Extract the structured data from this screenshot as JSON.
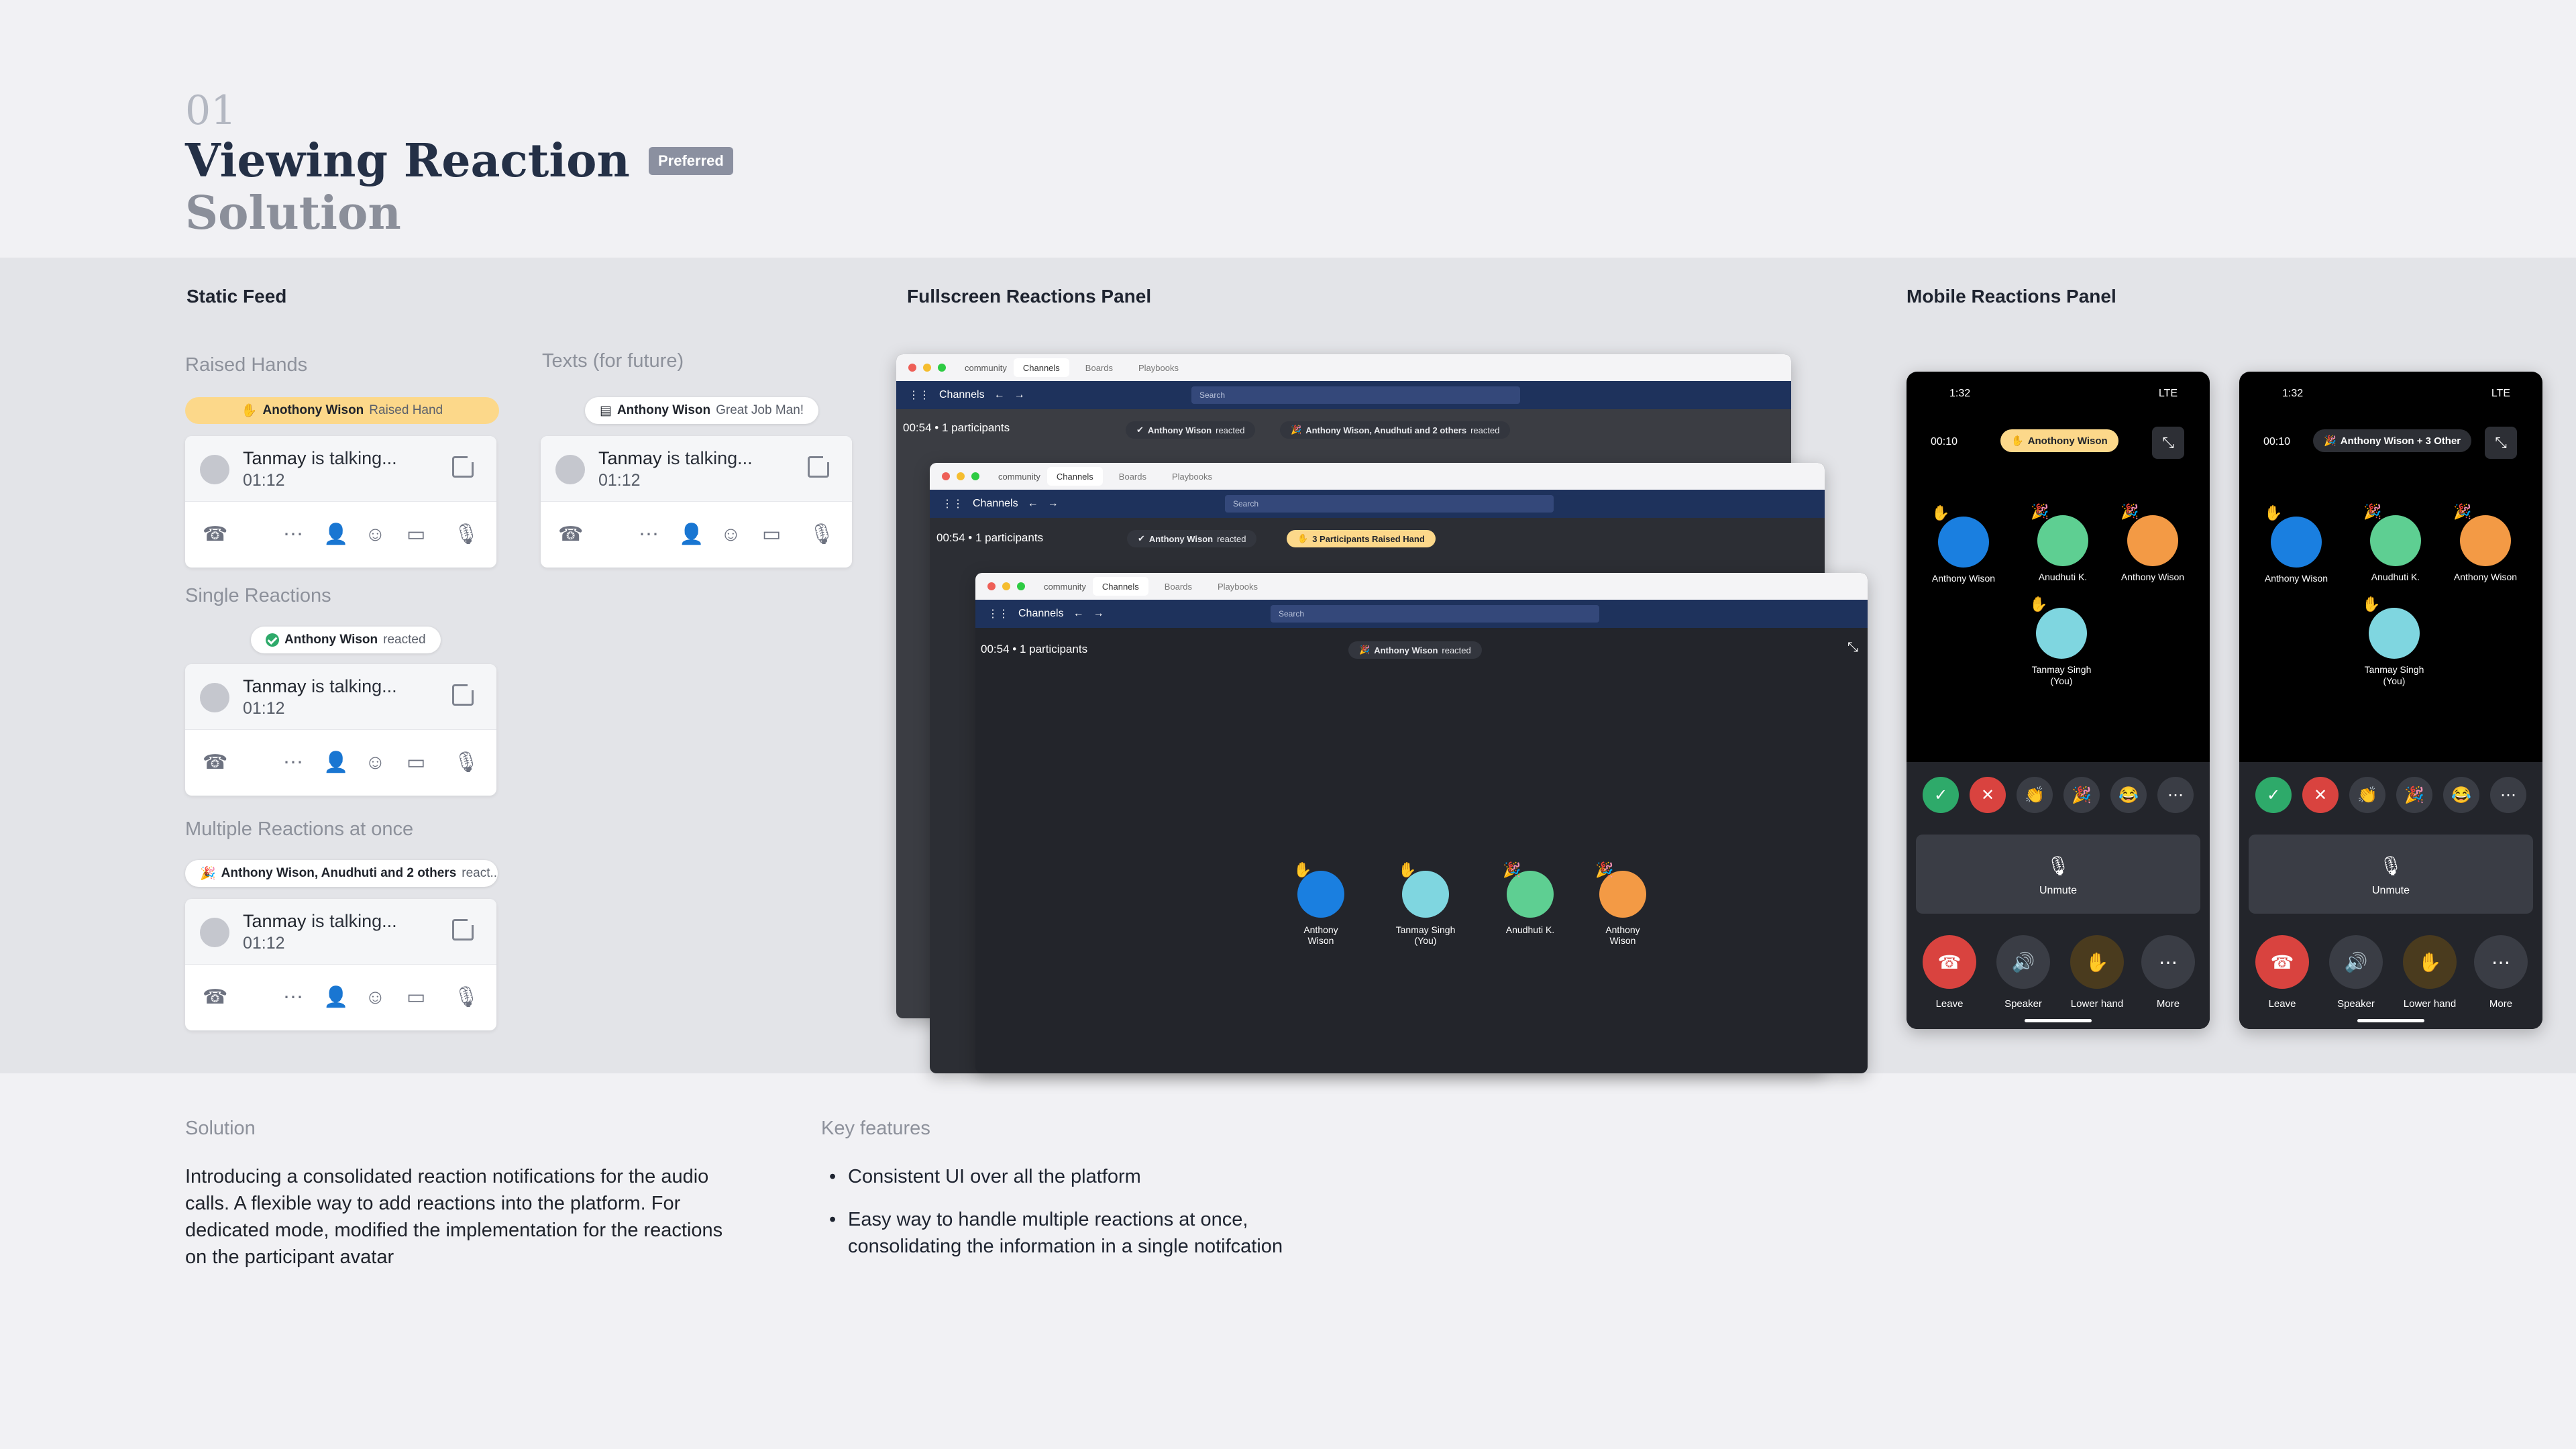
{
  "header": {
    "number": "01",
    "title": "Viewing Reaction",
    "badge": "Preferred",
    "subtitle": "Solution"
  },
  "sections": {
    "static": "Static Feed",
    "fullscreen": "Fullscreen Reactions Panel",
    "mobile": "Mobile Reactions Panel"
  },
  "static_feed": {
    "raised_hands": {
      "label": "Raised Hands",
      "pill_name": "Anothony Wison",
      "pill_action": "Raised Hand"
    },
    "texts": {
      "label": "Texts (for future)",
      "pill_name": "Anthony Wison",
      "pill_action": "Great Job Man!"
    },
    "single": {
      "label": "Single Reactions",
      "pill_name": "Anthony Wison",
      "pill_action": "reacted"
    },
    "multiple": {
      "label": "Multiple Reactions at once",
      "pill_name": "Anthony Wison, Anudhuti and 2 others",
      "pill_action": "react..."
    },
    "card": {
      "name": "Tanmay",
      "status": "is talking...",
      "time": "01:12"
    }
  },
  "desktop": {
    "app_name": "community",
    "tabs": [
      "Channels",
      "Boards",
      "Playbooks"
    ],
    "nav_title": "Channels",
    "search": "Search",
    "timer": "00:54",
    "participants": "1 participants",
    "win1": {
      "pill1_name": "Anthony Wison",
      "pill1_action": "reacted",
      "pill2_name": "Anthony Wison, Anudhuti and 2 others",
      "pill2_action": "reacted"
    },
    "win2": {
      "pill1_name": "Anthony Wison",
      "pill1_action": "reacted",
      "pill2": "3 Participants Raised Hand"
    },
    "win3": {
      "pill1_name": "Anthony Wison",
      "pill1_action": "reacted"
    },
    "people": [
      {
        "name": "Anthony Wison",
        "color": "#1a7fe0"
      },
      {
        "name": "Tanmay Singh",
        "sub": "(You)",
        "color": "#7fd6e0"
      },
      {
        "name": "Anudhuti K.",
        "color": "#5ecf92"
      },
      {
        "name": "Anthony Wison",
        "color": "#f39a45"
      }
    ]
  },
  "mobile": {
    "status_time": "1:32",
    "status_right": "LTE",
    "phone1": {
      "timer": "00:10",
      "pill": "Anothony Wison"
    },
    "phone2": {
      "timer": "00:10",
      "pill": "Anthony Wison + 3 Other"
    },
    "people": [
      {
        "name": "Anthony Wison",
        "color": "#1a7fe0"
      },
      {
        "name": "Anudhuti K.",
        "color": "#5ecf92"
      },
      {
        "name": "Anthony Wison",
        "color": "#f39a45"
      },
      {
        "name": "Tanmay Singh",
        "sub": "(You)",
        "color": "#7fd6e0"
      }
    ],
    "unmute": "Unmute",
    "controls": [
      "Leave",
      "Speaker",
      "Lower hand",
      "More"
    ]
  },
  "bottom": {
    "solution_label": "Solution",
    "solution_text": "Introducing a consolidated reaction notifications for the audio calls. A flexible way to add reactions into the platform. For dedicated mode, modified the implementation for the reactions on the participant avatar",
    "features_label": "Key features",
    "features": [
      "Consistent UI over all the platform",
      "Easy way to handle multiple reactions at once, consolidating the information in a single notifcation"
    ]
  }
}
